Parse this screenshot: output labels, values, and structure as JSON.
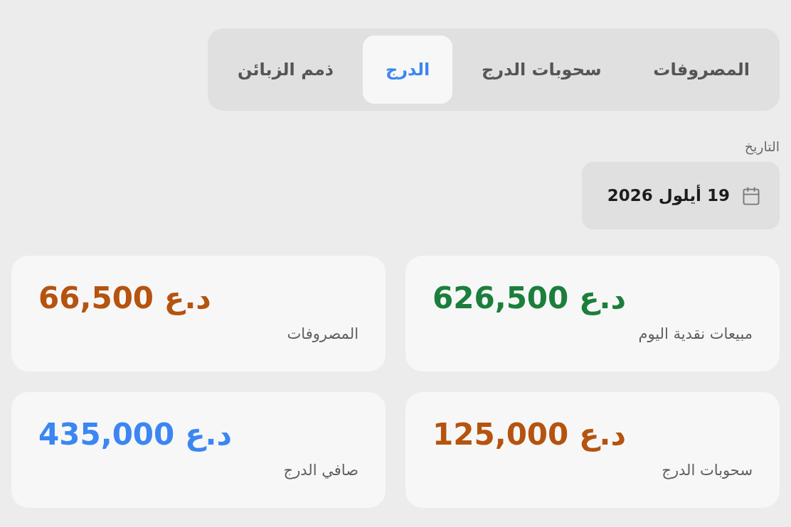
{
  "tabs": [
    {
      "label": "المصروفات",
      "selected": false
    },
    {
      "label": "سحوبات الدرج",
      "selected": false
    },
    {
      "label": "الدرج",
      "selected": true
    },
    {
      "label": "ذمم الزبائن",
      "selected": false
    }
  ],
  "date_field": {
    "label": "التاريخ",
    "value": "19 أيلول 2026"
  },
  "cards": [
    {
      "amount": "626,500 د.ع",
      "label": "مبيعات نقدية اليوم",
      "color": "#1b7f3b"
    },
    {
      "amount": "66,500 د.ع",
      "label": "المصروفات",
      "color": "#b5530f"
    },
    {
      "amount": "125,000 د.ع",
      "label": "سحوبات الدرج",
      "color": "#b5530f"
    },
    {
      "amount": "435,000 د.ع",
      "label": "صافي الدرج",
      "color": "#3b86f2"
    }
  ]
}
